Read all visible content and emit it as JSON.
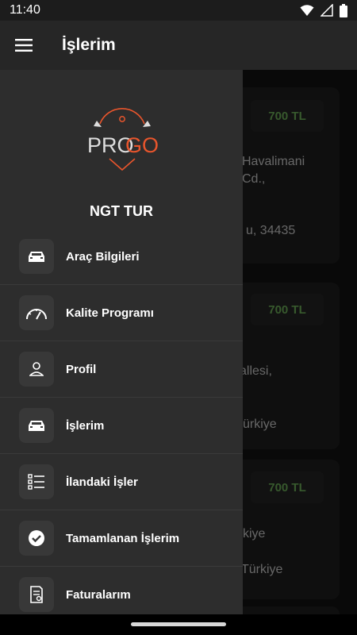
{
  "status_bar": {
    "time": "11:40"
  },
  "app_bar": {
    "title": "İşlerim"
  },
  "logo": {
    "text_left": "PRO",
    "text_right": "GO"
  },
  "drawer": {
    "company": "NGT TUR",
    "items": [
      {
        "label": "Araç Bilgileri",
        "icon": "car-icon"
      },
      {
        "label": "Kalite Programı",
        "icon": "speedometer-icon"
      },
      {
        "label": "Profil",
        "icon": "person-icon"
      },
      {
        "label": "İşlerim",
        "icon": "car-icon"
      },
      {
        "label": "İlandaki İşler",
        "icon": "checklist-icon"
      },
      {
        "label": "Tamamlanan İşlerim",
        "icon": "check-circle-icon"
      },
      {
        "label": "Faturalarım",
        "icon": "invoice-icon"
      }
    ]
  },
  "jobs": [
    {
      "price": "700 TL",
      "address_lines": [
        "Havalimani",
        "Cd.,"
      ],
      "address_line2": "u, 34435"
    },
    {
      "price": "700 TL",
      "address_lines": [
        "allesi,"
      ],
      "address_line2": "ürkiye"
    },
    {
      "price": "700 TL",
      "address_lines": [
        "kiye"
      ],
      "address_line2": "Türkiye"
    }
  ],
  "colors": {
    "accent": "#e8552c",
    "price_green": "#6fb35a",
    "drawer_bg": "#2d2d2d"
  }
}
